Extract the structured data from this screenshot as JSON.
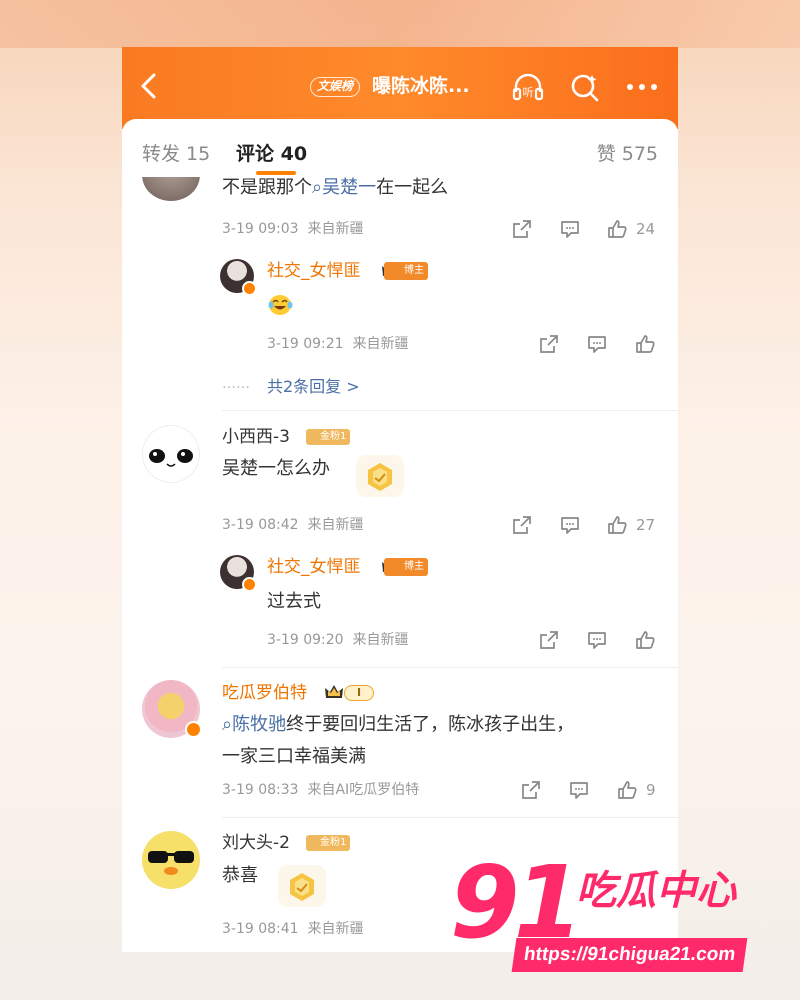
{
  "header": {
    "topic_tag": "文娱榜",
    "title": "曝陈冰陈...",
    "listen_label": "听"
  },
  "tabs": {
    "repost": "转发 15",
    "comment": "评论 40",
    "likes": "赞 575"
  },
  "comments": [
    {
      "text_prefix": "不是跟那个",
      "hashtag": "吴楚一",
      "text_suffix": "在一起么",
      "time": "3-19 09:03",
      "source": "来自新疆",
      "likes": "24",
      "reply": {
        "author": "社交_女悍匪",
        "badge": "博主",
        "content_icon": "laughing-emoji",
        "time": "3-19 09:21",
        "source": "来自新疆"
      },
      "more_replies": "共2条回复 >",
      "more_dots": "……"
    },
    {
      "author": "小西西-3",
      "badge": "金粉1",
      "text": "吴楚一怎么办",
      "time": "3-19 08:42",
      "source": "来自新疆",
      "likes": "27",
      "reply": {
        "author": "社交_女悍匪",
        "badge": "博主",
        "text": "过去式",
        "time": "3-19 09:20",
        "source": "来自新疆"
      }
    },
    {
      "author": "吃瓜罗伯特",
      "badge": "I",
      "hashtag": "陈牧驰",
      "text_line1": "终于要回归生活了，陈冰孩子出生，",
      "text_line2": "一家三口幸福美满",
      "time": "3-19 08:33",
      "source": "来自AI吃瓜罗伯特",
      "likes": "9"
    },
    {
      "author": "刘大头-2",
      "badge": "金粉1",
      "text": "恭喜",
      "time": "3-19 08:41",
      "source": "来自新疆"
    }
  ],
  "watermark": {
    "number": "91",
    "text": "吃瓜中心",
    "url": "https://91chigua21.com"
  },
  "colors": {
    "brand_orange": "#ff8200",
    "link_blue": "#4a6fa5",
    "watermark_pink": "#ff2a6a"
  }
}
